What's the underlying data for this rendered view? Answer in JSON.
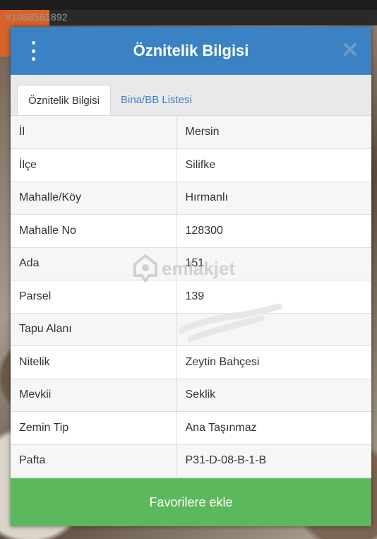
{
  "listing_id": "#1088561892",
  "modal": {
    "title": "Öznitelik Bilgisi",
    "tabs": [
      {
        "label": "Öznitelik Bilgisi",
        "active": true
      },
      {
        "label": "Bina/BB Listesi",
        "active": false
      }
    ],
    "rows": [
      {
        "label": "İl",
        "value": "Mersin"
      },
      {
        "label": "İlçe",
        "value": "Silifke"
      },
      {
        "label": "Mahalle/Köy",
        "value": "Hırmanlı"
      },
      {
        "label": "Mahalle No",
        "value": "128300"
      },
      {
        "label": "Ada",
        "value": "151"
      },
      {
        "label": "Parsel",
        "value": "139"
      },
      {
        "label": "Tapu Alanı",
        "value": ""
      },
      {
        "label": "Nitelik",
        "value": "Zeytin Bahçesi"
      },
      {
        "label": "Mevkii",
        "value": "Seklik"
      },
      {
        "label": "Zemin Tip",
        "value": "Ana Taşınmaz"
      },
      {
        "label": "Pafta",
        "value": "P31-D-08-B-1-B"
      }
    ],
    "favorite_button": "Favorilere ekle"
  },
  "watermark": "emlakjet",
  "colors": {
    "header_blue": "#3b82c4",
    "tab_link_blue": "#3b82c4",
    "favorite_green": "#5cb85c",
    "close_icon": "#6f98c2"
  },
  "icons": {
    "menu": "kebab-menu-icon",
    "close": "close-icon",
    "watermark_logo": "house-pin-icon"
  }
}
